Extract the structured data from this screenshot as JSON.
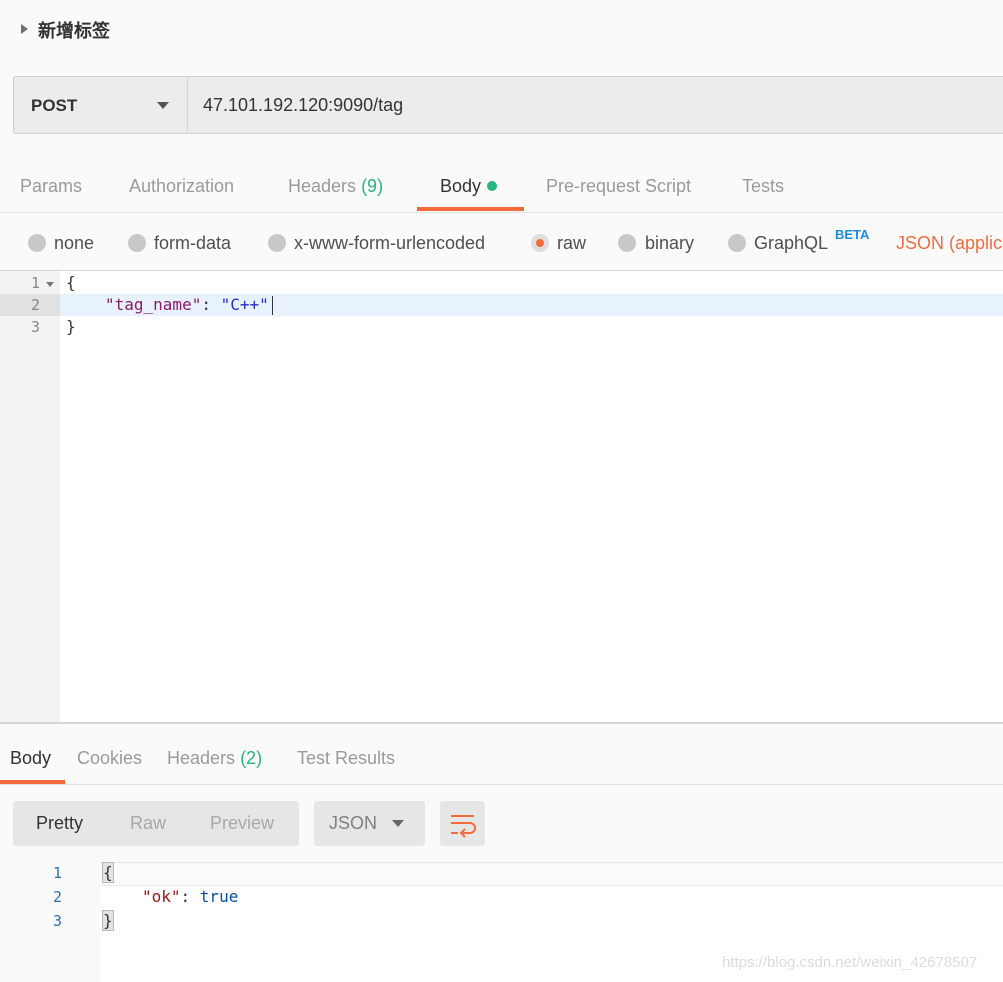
{
  "request": {
    "name": "新增标签",
    "method": "POST",
    "url": "47.101.192.120:9090/tag"
  },
  "request_tabs": [
    {
      "label": "Params"
    },
    {
      "label": "Authorization"
    },
    {
      "label": "Headers",
      "count": "(9)"
    },
    {
      "label": "Body",
      "active": true
    },
    {
      "label": "Pre-request Script"
    },
    {
      "label": "Tests"
    }
  ],
  "body_types": [
    "none",
    "form-data",
    "x-www-form-urlencoded",
    "raw",
    "binary",
    "GraphQL"
  ],
  "body_type_selected": "raw",
  "graphql_badge": "BETA",
  "content_type": "JSON (applica",
  "editor": {
    "line_numbers": [
      "1",
      "2",
      "3"
    ],
    "open_brace": "{",
    "close_brace": "}",
    "key": "\"tag_name\"",
    "colon": ": ",
    "value": "\"C++\""
  },
  "response_tabs": [
    {
      "label": "Body",
      "active": true
    },
    {
      "label": "Cookies"
    },
    {
      "label": "Headers",
      "count": "(2)"
    },
    {
      "label": "Test Results"
    }
  ],
  "response_view": {
    "modes": [
      "Pretty",
      "Raw",
      "Preview"
    ],
    "active_mode": "Pretty",
    "format": "JSON"
  },
  "response_body": {
    "line_numbers": [
      "1",
      "2",
      "3"
    ],
    "open_brace": "{",
    "close_brace": "}",
    "key": "\"ok\"",
    "colon": ": ",
    "value": "true"
  },
  "watermark": "https://blog.csdn.net/weixin_42678507",
  "colors": {
    "accent": "#f26b3a",
    "count_green": "#26b47f",
    "beta_blue": "#1a8ce0"
  }
}
